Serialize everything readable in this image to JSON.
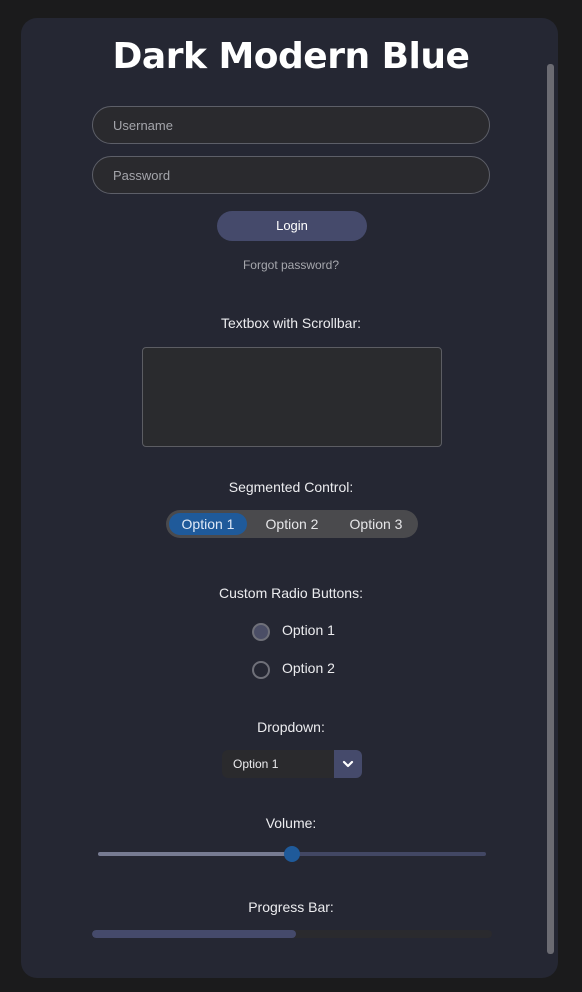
{
  "window": {
    "title": "Dark Modern Blue"
  },
  "login": {
    "username_placeholder": "Username",
    "password_placeholder": "Password",
    "login_label": "Login",
    "forgot_label": "Forgot password?"
  },
  "textbox": {
    "label": "Textbox with Scrollbar:",
    "value": ""
  },
  "segmented": {
    "label": "Segmented Control:",
    "options": [
      "Option 1",
      "Option 2",
      "Option 3"
    ],
    "selected_index": 0
  },
  "radio": {
    "label": "Custom Radio Buttons:",
    "options": [
      "Option 1",
      "Option 2"
    ],
    "selected_index": 0
  },
  "dropdown": {
    "label": "Dropdown:",
    "selected": "Option 1",
    "icon": "chevron-down-icon"
  },
  "volume": {
    "label": "Volume:",
    "value": 0.5
  },
  "progress": {
    "label": "Progress Bar:",
    "value": 0.51
  },
  "colors": {
    "accent": "#1f5a9a",
    "button": "#454a6b",
    "panel": "#252733",
    "background": "#1b1b1c"
  }
}
